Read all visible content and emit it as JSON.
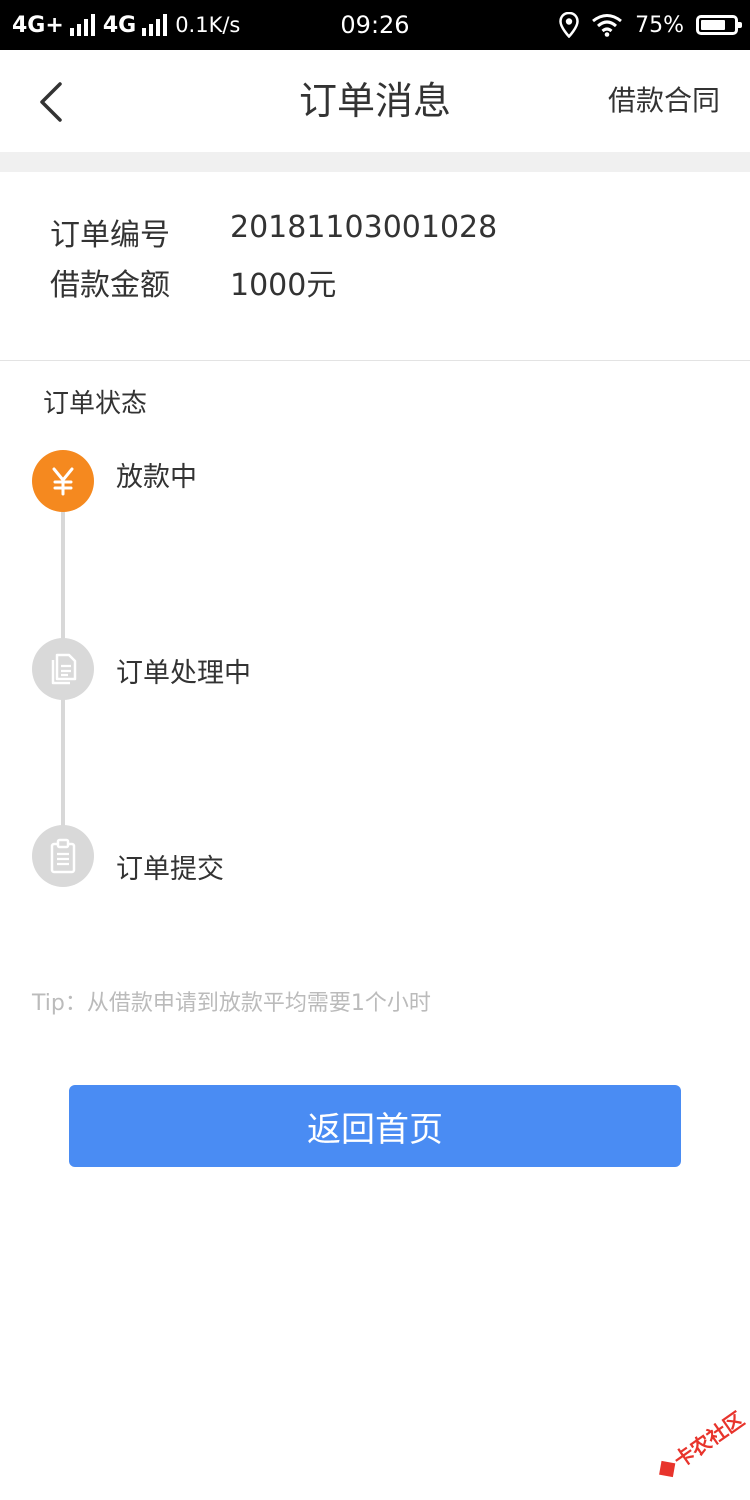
{
  "status_bar": {
    "network1": "4G+",
    "network2": "4G",
    "speed": "0.1K/s",
    "time": "09:26",
    "battery": "75%",
    "battery_level": 0.75,
    "icons": [
      "signal-icon",
      "location-icon",
      "wifi-icon",
      "battery-icon"
    ]
  },
  "header": {
    "title": "订单消息",
    "contract_link": "借款合同",
    "back_icon": "chevron-left-icon"
  },
  "order_info": {
    "order_no_label": "订单编号",
    "order_no_value": "20181103001028",
    "amount_label": "借款金额",
    "amount_value": "1000元"
  },
  "order_status": {
    "title": "订单状态",
    "steps": [
      {
        "label": "放款中",
        "icon": "yen-icon",
        "state": "active"
      },
      {
        "label": "订单处理中",
        "icon": "documents-icon",
        "state": "inactive"
      },
      {
        "label": "订单提交",
        "icon": "clipboard-icon",
        "state": "inactive"
      }
    ]
  },
  "tip": "Tip：从借款申请到放款平均需要1个小时",
  "home_button": "返回首页",
  "watermark": "卡农社区",
  "colors": {
    "accent_orange": "#f5891f",
    "primary_blue": "#4a8cf3",
    "inactive_gray": "#d9d9d9",
    "watermark_red": "#e8342c"
  }
}
